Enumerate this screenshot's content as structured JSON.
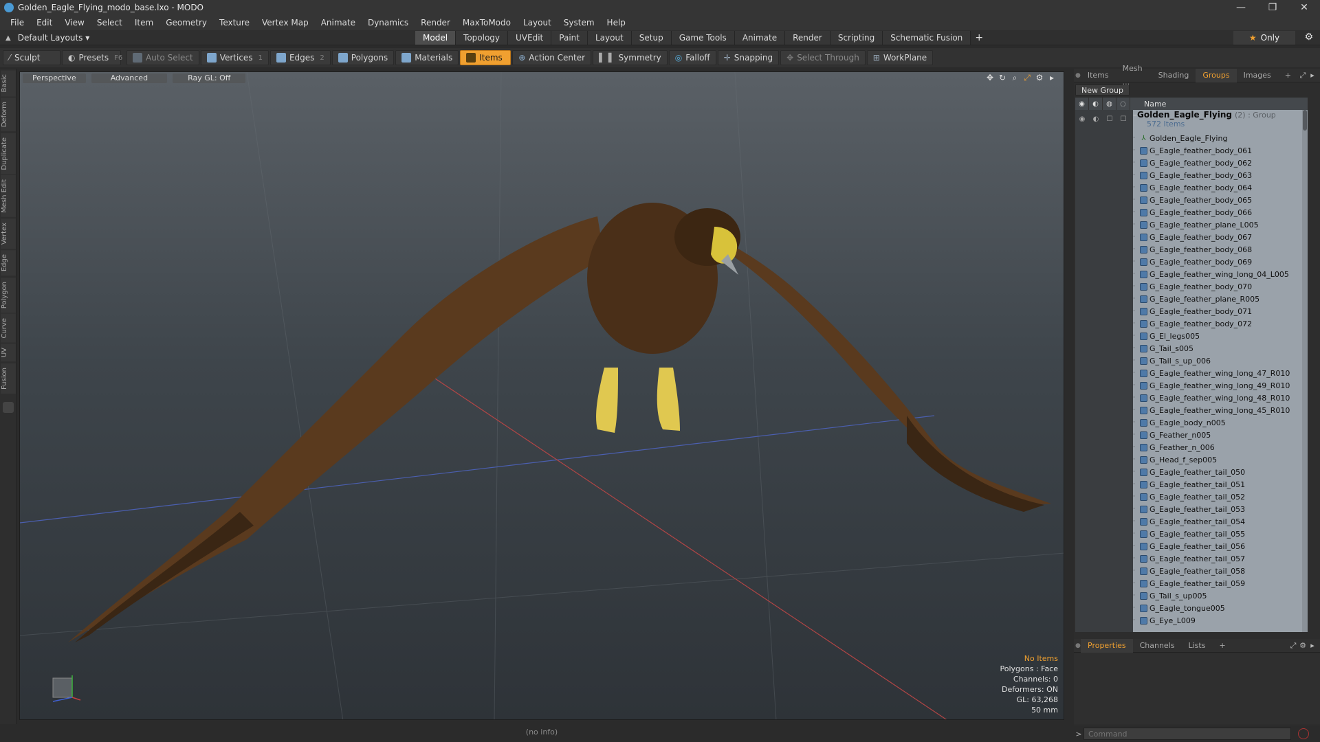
{
  "window": {
    "title": "Golden_Eagle_Flying_modo_base.lxo - MODO",
    "controls": [
      "—",
      "❐",
      "✕"
    ]
  },
  "menu": [
    "File",
    "Edit",
    "View",
    "Select",
    "Item",
    "Geometry",
    "Texture",
    "Vertex Map",
    "Animate",
    "Dynamics",
    "Render",
    "MaxToModo",
    "Layout",
    "System",
    "Help"
  ],
  "layout": {
    "selector": "Default Layouts",
    "tabs": [
      "Model",
      "Topology",
      "UVEdit",
      "Paint",
      "Layout",
      "Setup",
      "Game Tools",
      "Animate",
      "Render",
      "Scripting",
      "Schematic Fusion"
    ],
    "active_tab": "Model",
    "only_label": "Only"
  },
  "toolbar": {
    "sculpt": "Sculpt",
    "presets": "Presets",
    "presets_key": "F6",
    "auto_select": "Auto Select",
    "vertices": "Vertices",
    "vertices_key": "1",
    "edges": "Edges",
    "edges_key": "2",
    "polygons": "Polygons",
    "materials": "Materials",
    "items": "Items",
    "action_center": "Action Center",
    "symmetry": "Symmetry",
    "falloff": "Falloff",
    "snapping": "Snapping",
    "select_through": "Select Through",
    "workplane": "WorkPlane"
  },
  "left_tabs": [
    "Basic",
    "Deform",
    "Duplicate",
    "Mesh Edit",
    "Vertex",
    "Edge",
    "Polygon",
    "Curve",
    "UV",
    "Fusion"
  ],
  "viewport": {
    "view": "Perspective",
    "shading": "Advanced",
    "raygl": "Ray GL: Off",
    "info": {
      "selection": "No Items",
      "polygons": "Polygons : Face",
      "channels": "Channels: 0",
      "deformers": "Deformers: ON",
      "gl": "GL: 63,268",
      "focal": "50 mm"
    }
  },
  "status": "(no info)",
  "right_panel": {
    "tabs": [
      "Items",
      "Mesh ...",
      "Shading",
      "Groups",
      "Images"
    ],
    "active_tab": "Groups",
    "new_group": "New Group",
    "column_name": "Name",
    "group": {
      "name": "Golden_Eagle_Flying",
      "count": "(2) : Group",
      "items": "572 Items"
    },
    "locator": "Golden_Eagle_Flying",
    "meshes": [
      "G_Eagle_feather_body_061",
      "G_Eagle_feather_body_062",
      "G_Eagle_feather_body_063",
      "G_Eagle_feather_body_064",
      "G_Eagle_feather_body_065",
      "G_Eagle_feather_body_066",
      "G_Eagle_feather_plane_L005",
      "G_Eagle_feather_body_067",
      "G_Eagle_feather_body_068",
      "G_Eagle_feather_body_069",
      "G_Eagle_feather_wing_long_04_L005",
      "G_Eagle_feather_body_070",
      "G_Eagle_feather_plane_R005",
      "G_Eagle_feather_body_071",
      "G_Eagle_feather_body_072",
      "G_El_legs005",
      "G_Tail_s005",
      "G_Tail_s_up_006",
      "G_Eagle_feather_wing_long_47_R010",
      "G_Eagle_feather_wing_long_49_R010",
      "G_Eagle_feather_wing_long_48_R010",
      "G_Eagle_feather_wing_long_45_R010",
      "G_Eagle_body_n005",
      "G_Feather_n005",
      "G_Feather_n_006",
      "G_Head_f_sep005",
      "G_Eagle_feather_tail_050",
      "G_Eagle_feather_tail_051",
      "G_Eagle_feather_tail_052",
      "G_Eagle_feather_tail_053",
      "G_Eagle_feather_tail_054",
      "G_Eagle_feather_tail_055",
      "G_Eagle_feather_tail_056",
      "G_Eagle_feather_tail_057",
      "G_Eagle_feather_tail_058",
      "G_Eagle_feather_tail_059",
      "G_Tail_s_up005",
      "G_Eagle_tongue005",
      "G_Eye_L009"
    ],
    "bottom_tabs": [
      "Properties",
      "Channels",
      "Lists"
    ],
    "bottom_active": "Properties",
    "command_placeholder": "Command"
  },
  "colors": {
    "accent": "#f0a030",
    "tree_bg": "#9aa2aa",
    "viewport_top": "#5a6066",
    "viewport_bottom": "#2e3338"
  }
}
